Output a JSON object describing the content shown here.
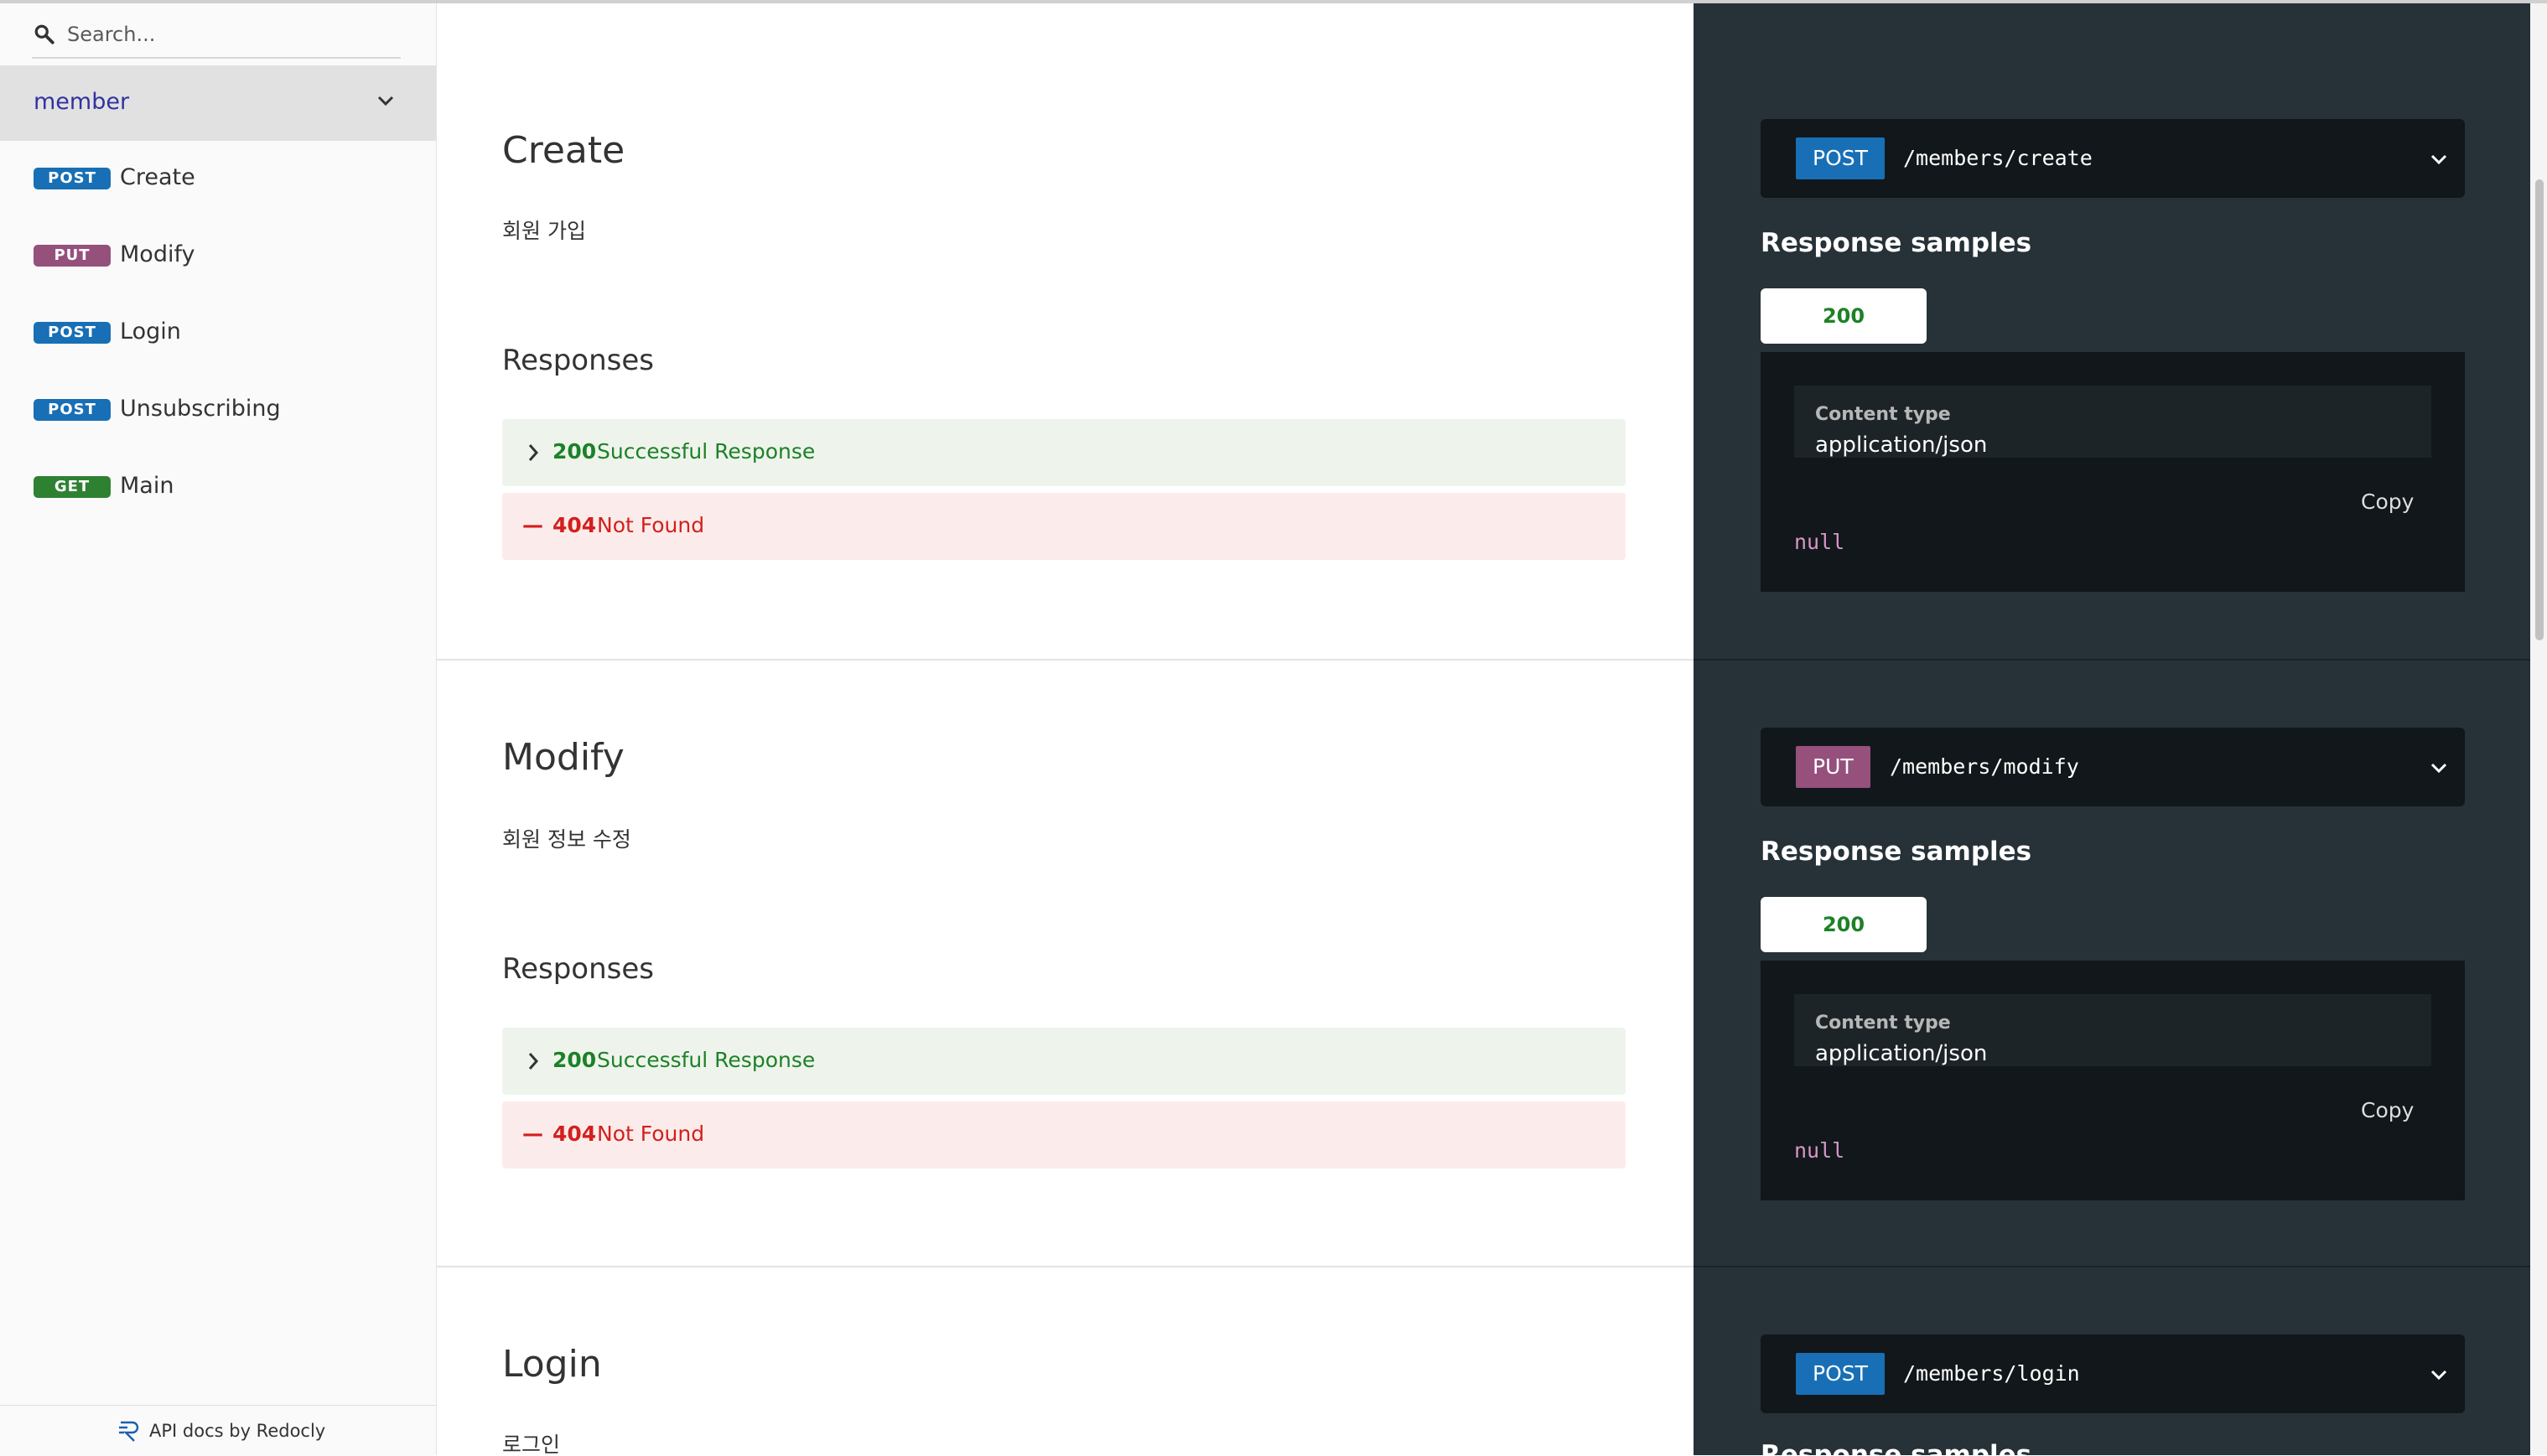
{
  "search": {
    "placeholder": "Search..."
  },
  "sidebar": {
    "group": "member",
    "items": [
      {
        "method": "POST",
        "label": "Create"
      },
      {
        "method": "PUT",
        "label": "Modify"
      },
      {
        "method": "POST",
        "label": "Login"
      },
      {
        "method": "POST",
        "label": "Unsubscribing"
      },
      {
        "method": "GET",
        "label": "Main"
      }
    ],
    "footer": "API docs by Redocly"
  },
  "operations": [
    {
      "title": "Create",
      "description": "회원 가입",
      "responses_heading": "Responses",
      "responses": [
        {
          "code": "200",
          "text": "Successful Response"
        },
        {
          "code": "404",
          "text": "Not Found"
        }
      ],
      "method": "POST",
      "path": "/members/create",
      "samples_title": "Response samples",
      "tab": "200",
      "content_type_label": "Content type",
      "content_type": "application/json",
      "copy": "Copy",
      "body": "null"
    },
    {
      "title": "Modify",
      "description": "회원 정보 수정",
      "responses_heading": "Responses",
      "responses": [
        {
          "code": "200",
          "text": "Successful Response"
        },
        {
          "code": "404",
          "text": "Not Found"
        }
      ],
      "method": "PUT",
      "path": "/members/modify",
      "samples_title": "Response samples",
      "tab": "200",
      "content_type_label": "Content type",
      "content_type": "application/json",
      "copy": "Copy",
      "body": "null"
    },
    {
      "title": "Login",
      "description": "로그인",
      "method": "POST",
      "path": "/members/login",
      "samples_title": "Response samples"
    }
  ],
  "colors": {
    "post": "#186fb5",
    "put": "#95507c",
    "get": "#2f8132",
    "success": "#1d8127",
    "error": "#d41f1c",
    "panel": "#263238"
  }
}
